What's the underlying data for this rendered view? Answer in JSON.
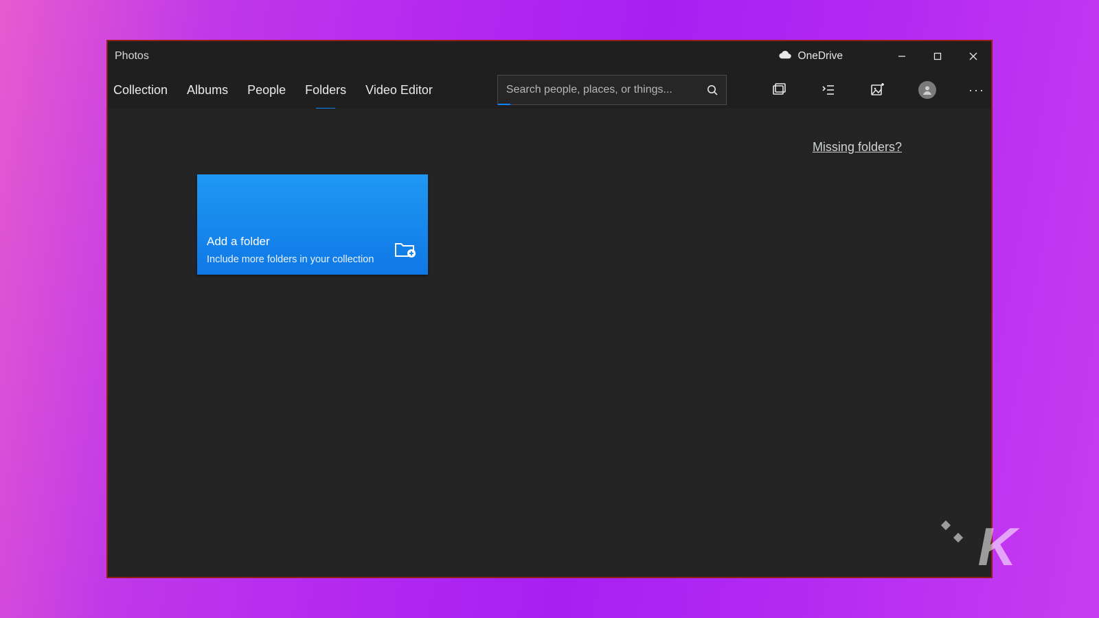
{
  "titlebar": {
    "app_title": "Photos",
    "onedrive_label": "OneDrive"
  },
  "nav": {
    "tabs": {
      "0": {
        "label": "Collection"
      },
      "1": {
        "label": "Albums"
      },
      "2": {
        "label": "People"
      },
      "3": {
        "label": "Folders"
      },
      "4": {
        "label": "Video Editor"
      }
    },
    "active_index": 3,
    "search_placeholder": "Search people, places, or things..."
  },
  "content": {
    "missing_link": "Missing folders?",
    "add_tile": {
      "title": "Add a folder",
      "subtitle": "Include more folders in your collection"
    }
  },
  "colors": {
    "accent": "#0a84ff",
    "tile_blue": "#1a88ef",
    "window_border": "#8f1f16"
  }
}
